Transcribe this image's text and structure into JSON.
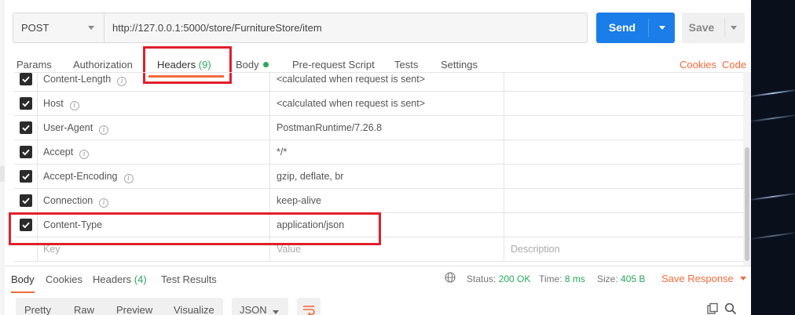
{
  "request": {
    "method": "POST",
    "url": "http://127.0.0.1:5000/store/FurnitureStore/item",
    "send_label": "Send",
    "save_label": "Save"
  },
  "request_tabs": {
    "params": "Params",
    "authorization": "Authorization",
    "headers_label": "Headers",
    "headers_count": "(9)",
    "body": "Body",
    "pre_request": "Pre-request Script",
    "tests": "Tests",
    "settings": "Settings",
    "cookies": "Cookies",
    "code": "Code"
  },
  "headers": [
    {
      "key": "Content-Length",
      "value": "<calculated when request is sent>",
      "info": true
    },
    {
      "key": "Host",
      "value": "<calculated when request is sent>",
      "info": true
    },
    {
      "key": "User-Agent",
      "value": "PostmanRuntime/7.26.8",
      "info": true
    },
    {
      "key": "Accept",
      "value": "*/*",
      "info": true
    },
    {
      "key": "Accept-Encoding",
      "value": "gzip, deflate, br",
      "info": true
    },
    {
      "key": "Connection",
      "value": "keep-alive",
      "info": true
    },
    {
      "key": "Content-Type",
      "value": "application/json",
      "info": false
    }
  ],
  "headers_placeholder": {
    "key": "Key",
    "value": "Value",
    "description": "Description"
  },
  "response": {
    "tabs": {
      "body": "Body",
      "cookies": "Cookies",
      "headers_label": "Headers",
      "headers_count": "(4)",
      "test_results": "Test Results"
    },
    "status_label": "Status:",
    "status_value": "200 OK",
    "time_label": "Time:",
    "time_value": "8 ms",
    "size_label": "Size:",
    "size_value": "405 B",
    "save_response": "Save Response"
  },
  "view": {
    "pretty": "Pretty",
    "raw": "Raw",
    "preview": "Preview",
    "visualize": "Visualize",
    "format": "JSON"
  },
  "colors": {
    "accent": "#f26b3a",
    "send": "#1b7de8",
    "success": "#2aa85a",
    "highlight": "#e11f2b"
  }
}
